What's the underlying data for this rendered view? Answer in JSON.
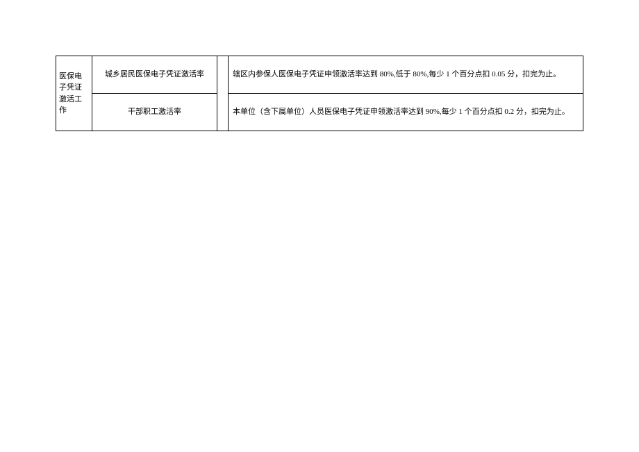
{
  "table": {
    "category": "医保电子凭证激活工作",
    "rows": [
      {
        "metric": "城乡居民医保电子凭证激活率",
        "desc": "辖区内参保人医保电子凭证申领激活率达到 80%,低于 80%,每少 1 个百分点扣 0.05 分，扣完为止。"
      },
      {
        "metric": "干部职工激活率",
        "desc": "本单位（含下属单位）人员医保电子凭证申领激活率达到 90%,每少 1 个百分点扣 0.2 分，扣完为止。"
      }
    ]
  }
}
